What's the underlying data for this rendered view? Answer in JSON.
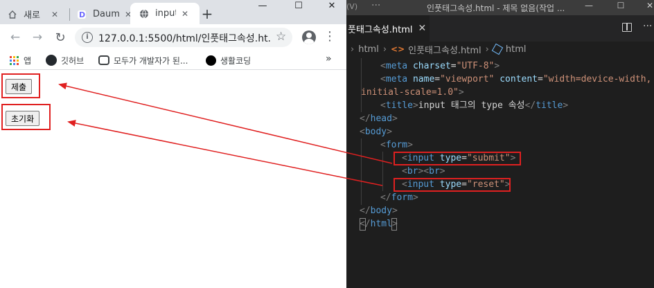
{
  "browser": {
    "tabs": [
      {
        "title": "새로",
        "icon": "home-icon"
      },
      {
        "title": "Daum",
        "icon": "daum-logo-icon"
      },
      {
        "title": "input",
        "icon": "globe-icon",
        "active": true
      }
    ],
    "new_tab": "+",
    "window_controls": {
      "minimize": "—",
      "maximize": "☐",
      "close": "✕"
    },
    "toolbar": {
      "back": "←",
      "forward": "→",
      "reload": "↻",
      "url": "127.0.0.1:5500/html/인풋태그속성.ht...",
      "star": "☆",
      "menu": "⋮"
    },
    "bookmarks": [
      {
        "label": "앱",
        "icon": "apps-grid-icon"
      },
      {
        "label": "깃허브",
        "icon": "github-icon"
      },
      {
        "label": "모두가 개발자가 된...",
        "icon": "cloud-icon"
      },
      {
        "label": "생활코딩",
        "icon": "black-dot-icon"
      }
    ],
    "bookmarks_more": "»",
    "page": {
      "submit_label": "제출",
      "reset_label": "초기화"
    }
  },
  "vscode": {
    "menu_v": "(V)",
    "menu_dots": "···",
    "window_title": "인풋태그속성.html - 제목 없음(작업 ...",
    "window_controls": {
      "minimize": "—",
      "maximize": "☐",
      "close": "✕"
    },
    "tab_label": "풋태그속성.html",
    "tab_close": "✕",
    "more": "···",
    "breadcrumb": [
      "html",
      "인풋태그속성.html",
      "html"
    ],
    "breadcrumb_sep": "›",
    "code": {
      "meta_charset": {
        "tag": "meta",
        "attr": "charset",
        "value": "\"UTF-8\""
      },
      "meta_viewport": {
        "tag": "meta",
        "attr1": "name",
        "value1": "\"viewport\"",
        "attr2": "content",
        "value2a": "\"width=device-width,",
        "value2b": "initial-scale=1.0\""
      },
      "title": {
        "tag": "title",
        "text": "input 태그의 type 속성"
      },
      "head_close": "head",
      "body_open": "body",
      "form_open": "form",
      "input_submit": {
        "tag": "input",
        "attr": "type",
        "value": "\"submit\""
      },
      "br": "br",
      "input_reset": {
        "tag": "input",
        "attr": "type",
        "value": "\"reset\""
      },
      "form_close": "form",
      "body_close": "body",
      "html_close": "html"
    }
  },
  "colors": {
    "annotation_red": "#e02020",
    "tag": "#569cd6",
    "attribute": "#9cdcfe",
    "string": "#ce9178",
    "bracket": "#808080"
  }
}
